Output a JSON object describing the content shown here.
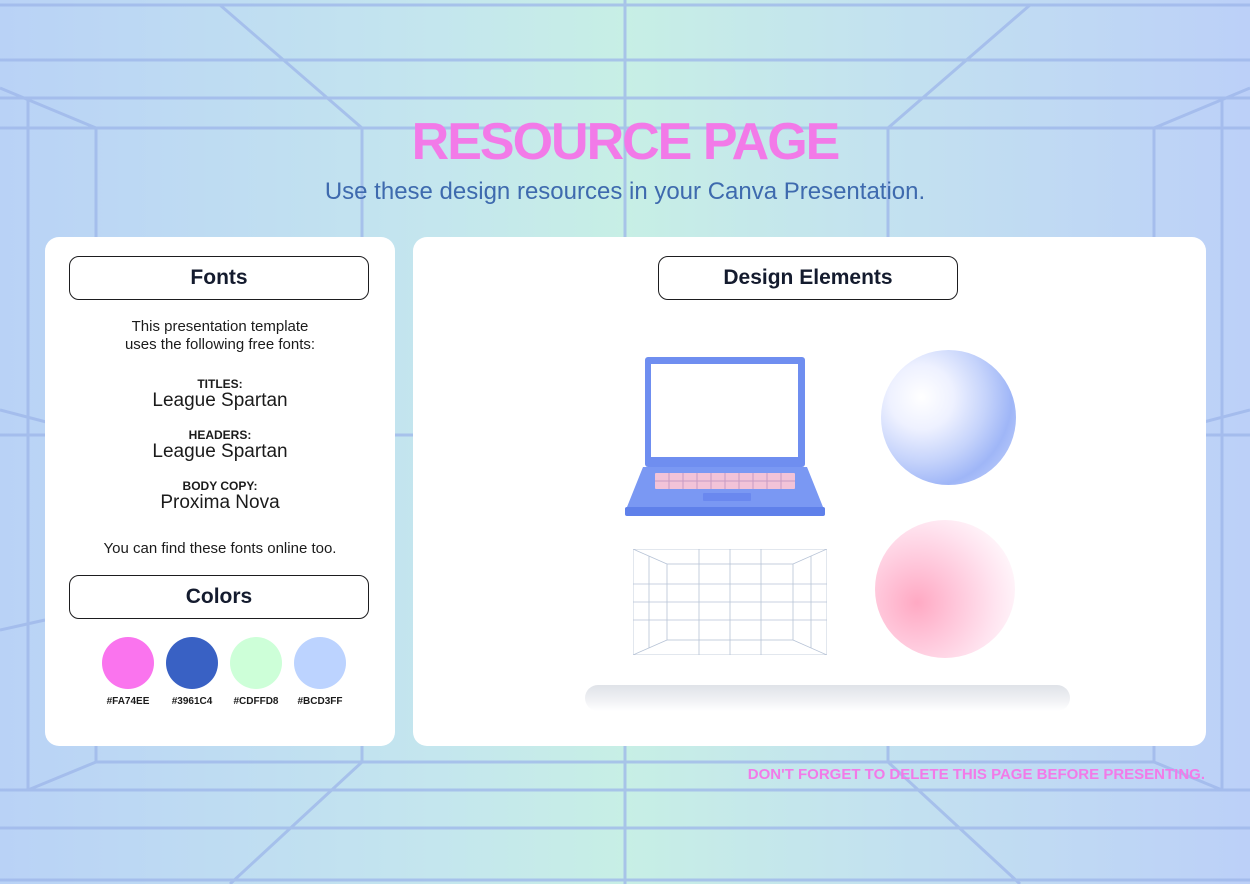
{
  "header": {
    "title": "RESOURCE PAGE",
    "subtitle": "Use these design resources in your Canva Presentation."
  },
  "fonts_panel": {
    "heading": "Fonts",
    "intro_line1": "This presentation template",
    "intro_line2": "uses the following free fonts:",
    "groups": [
      {
        "label": "TITLES:",
        "font": "League Spartan"
      },
      {
        "label": "HEADERS:",
        "font": "League Spartan"
      },
      {
        "label": "BODY COPY:",
        "font": "Proxima Nova"
      }
    ],
    "note": "You can find these fonts online too."
  },
  "colors_panel": {
    "heading": "Colors",
    "swatches": [
      {
        "hex": "#FA74EE",
        "color": "#FA74EE"
      },
      {
        "hex": "#3961C4",
        "color": "#3961C4"
      },
      {
        "hex": "#CDFFD8",
        "color": "#CDFFD8"
      },
      {
        "hex": "#BCD3FF",
        "color": "#BCD3FF"
      }
    ]
  },
  "design_panel": {
    "heading": "Design Elements",
    "elements": [
      "laptop",
      "blue-sphere",
      "wireframe-room",
      "pink-sphere",
      "shelf-bar"
    ]
  },
  "footer": {
    "warning": "DON'T FORGET TO DELETE THIS PAGE BEFORE PRESENTING."
  },
  "theme": {
    "accent_pink": "#F27AE8",
    "subtitle_blue": "#3E6AAE"
  }
}
